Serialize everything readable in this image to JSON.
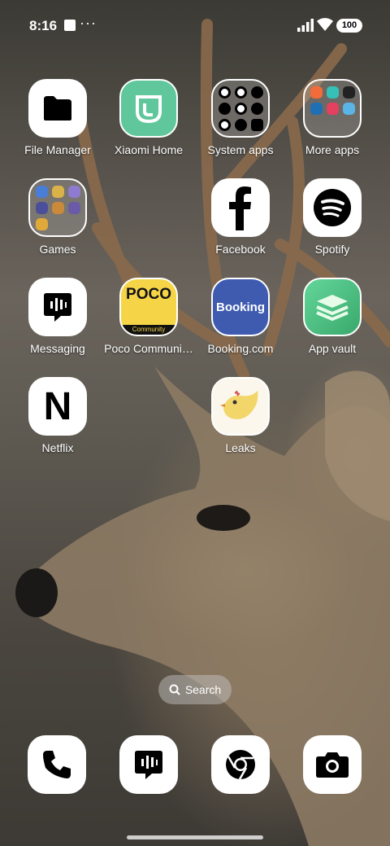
{
  "status_bar": {
    "time": "8:16",
    "overflow": "···",
    "battery": "100"
  },
  "apps": [
    {
      "key": "file-manager",
      "label": "File Manager",
      "icon": "folder-icon"
    },
    {
      "key": "xiaomi-home",
      "label": "Xiaomi Home",
      "icon": "mi-home-icon",
      "color": "#5fc79b"
    },
    {
      "key": "system-apps",
      "label": "System apps",
      "icon": "folder-grid-icon"
    },
    {
      "key": "more-apps",
      "label": "More apps",
      "icon": "folder-grid-icon"
    },
    {
      "key": "games",
      "label": "Games",
      "icon": "folder-grid-icon"
    },
    {
      "key": "facebook",
      "label": "Facebook",
      "icon": "facebook-icon"
    },
    {
      "key": "spotify",
      "label": "Spotify",
      "icon": "spotify-icon"
    },
    {
      "key": "messaging",
      "label": "Messaging",
      "icon": "message-icon"
    },
    {
      "key": "poco-community",
      "label": "Poco Communi…",
      "icon": "poco-icon",
      "icon_text": "POCO",
      "icon_subtext": "Community",
      "color": "#f5d547"
    },
    {
      "key": "booking",
      "label": "Booking.com",
      "icon": "booking-icon",
      "icon_text": "Booking",
      "color": "#3e5bb0"
    },
    {
      "key": "app-vault",
      "label": "App vault",
      "icon": "stack-icon",
      "color": "#58c87a"
    },
    {
      "key": "netflix",
      "label": "Netflix",
      "icon": "netflix-icon",
      "icon_text": "N"
    },
    {
      "key": "leaks",
      "label": "Leaks",
      "icon": "bird-icon",
      "color": "#f2d66a"
    }
  ],
  "search": {
    "label": "Search",
    "icon": "search-icon"
  },
  "dock": [
    {
      "key": "phone",
      "icon": "phone-icon"
    },
    {
      "key": "messages",
      "icon": "message-icon"
    },
    {
      "key": "chrome",
      "icon": "chrome-icon"
    },
    {
      "key": "camera",
      "icon": "camera-icon"
    }
  ]
}
